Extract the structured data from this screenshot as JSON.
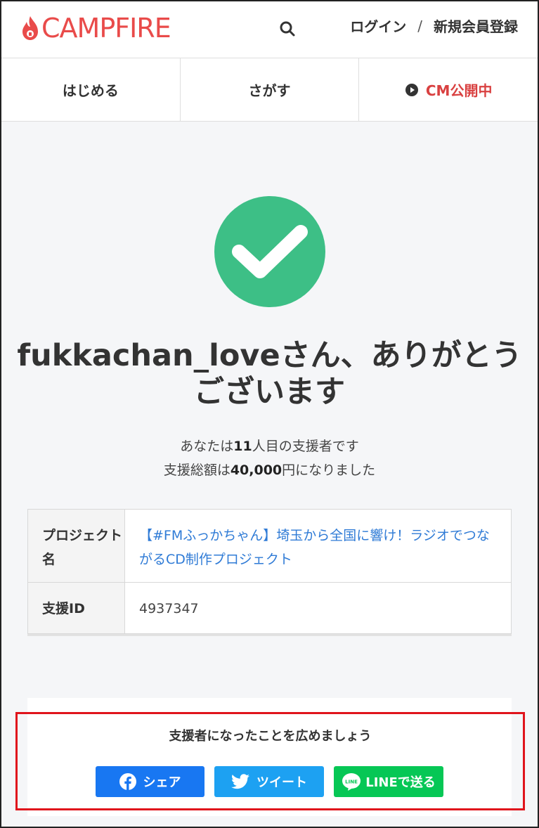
{
  "header": {
    "logo": "CAMPFIRE",
    "login": "ログイン",
    "separator": "/",
    "signup": "新規会員登録"
  },
  "nav": {
    "start": "はじめる",
    "explore": "さがす",
    "cm": "CM公開中"
  },
  "thanks": {
    "title_line1": "fukkachan_loveさん、ありがとう",
    "title_line2": "ございます",
    "info_pre1": "あなたは",
    "supporter_number": "11",
    "info_post1": "人目の支援者です",
    "info_pre2": "支援総額は",
    "total_amount": "40,000",
    "info_post2": "円になりました"
  },
  "table": {
    "project_label": "プロジェクト名",
    "project_name": "【#FMふっかちゃん】埼玉から全国に響け！ラジオでつながるCD制作プロジェクト",
    "support_id_label": "支援ID",
    "support_id": "4937347"
  },
  "share": {
    "title": "支援者になったことを広めましょう",
    "facebook": "シェア",
    "twitter": "ツイート",
    "line": "LINEで送る"
  },
  "colors": {
    "brand": "#e94b4a",
    "check": "#3dbf86",
    "link": "#2f7bd6",
    "highlight_box": "#e0141c"
  }
}
